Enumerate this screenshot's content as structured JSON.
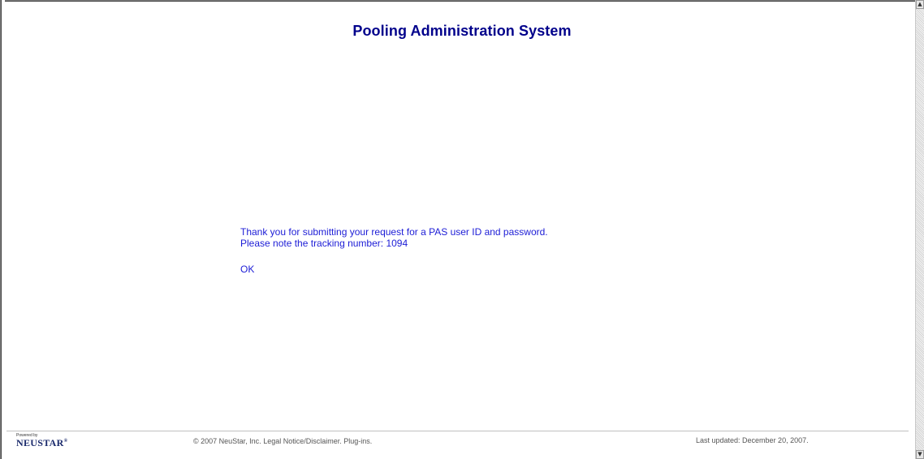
{
  "page": {
    "title": "Pooling Administration System"
  },
  "message": {
    "line1": "Thank you for submitting your request for a PAS user ID and password.",
    "line2_prefix": "Please note the tracking number: ",
    "tracking_number": "1094",
    "ok_label": "OK"
  },
  "footer": {
    "logo_powered_by": "Powered by",
    "logo_name": "NEUSTAR",
    "logo_mark": "®",
    "copyright": "© 2007 NeuStar, Inc.",
    "legal_link": "Legal Notice/Disclaimer.",
    "plugins_link": "Plug-ins.",
    "last_updated": "Last updated: December 20, 2007."
  },
  "scrollbar": {
    "up_icon": "▲",
    "down_icon": "▼"
  },
  "colors": {
    "title": "#00008b",
    "message_text": "#1c1cd6",
    "footer_text": "#555555"
  }
}
